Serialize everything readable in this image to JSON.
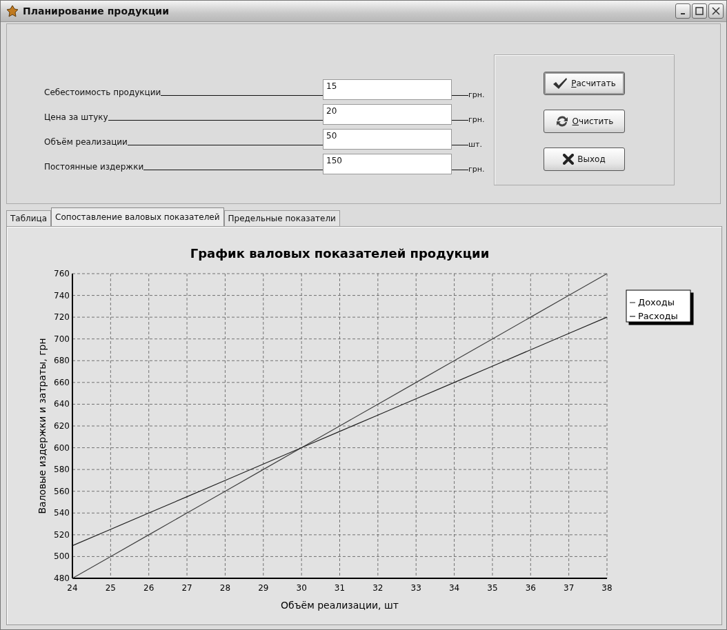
{
  "window": {
    "title": "Планирование продукции"
  },
  "fields": [
    {
      "label": "Себестоимость продукции",
      "value": "15",
      "unit": "грн."
    },
    {
      "label": "Цена за штуку",
      "value": "20",
      "unit": "грн."
    },
    {
      "label": "Объём реализации",
      "value": "50",
      "unit": "шт."
    },
    {
      "label": "Постоянные издержки",
      "value": "150",
      "unit": "грн."
    }
  ],
  "buttons": [
    {
      "label": "Расчитать",
      "kind": "check",
      "mnemonic": true,
      "focused": true
    },
    {
      "label": "Очистить",
      "kind": "refresh",
      "mnemonic": true,
      "focused": false
    },
    {
      "label": "Выход",
      "kind": "cross",
      "mnemonic": false,
      "focused": false
    }
  ],
  "tabs": [
    {
      "label": "Таблица",
      "selected": false
    },
    {
      "label": "Сопоставление валовых показателей",
      "selected": true
    },
    {
      "label": "Предельные показатели",
      "selected": false
    }
  ],
  "chart": {
    "chart_data": {
      "type": "line",
      "title": "График валовых показателей продукции",
      "xlabel": "Объём реализации, шт",
      "ylabel": "Валовые издержки и затраты, грн",
      "x": [
        24,
        25,
        26,
        27,
        28,
        29,
        30,
        31,
        32,
        33,
        34,
        35,
        36,
        37,
        38
      ],
      "series": [
        {
          "name": "Доходы",
          "color": "#404040",
          "values": [
            480,
            500,
            520,
            540,
            560,
            580,
            600,
            620,
            640,
            660,
            680,
            700,
            720,
            740,
            760
          ]
        },
        {
          "name": "Расходы",
          "color": "#202020",
          "values": [
            510,
            525,
            540,
            555,
            570,
            585,
            600,
            615,
            630,
            645,
            660,
            675,
            690,
            705,
            720
          ]
        }
      ],
      "grid": true,
      "legend": true,
      "xlim": [
        24,
        38
      ],
      "ylim": [
        480,
        760
      ],
      "xticks": [
        24,
        25,
        26,
        27,
        28,
        29,
        30,
        31,
        32,
        33,
        34,
        35,
        36,
        37,
        38
      ],
      "yticks": [
        480,
        500,
        520,
        540,
        560,
        580,
        600,
        620,
        640,
        660,
        680,
        700,
        720,
        740,
        760
      ]
    }
  }
}
